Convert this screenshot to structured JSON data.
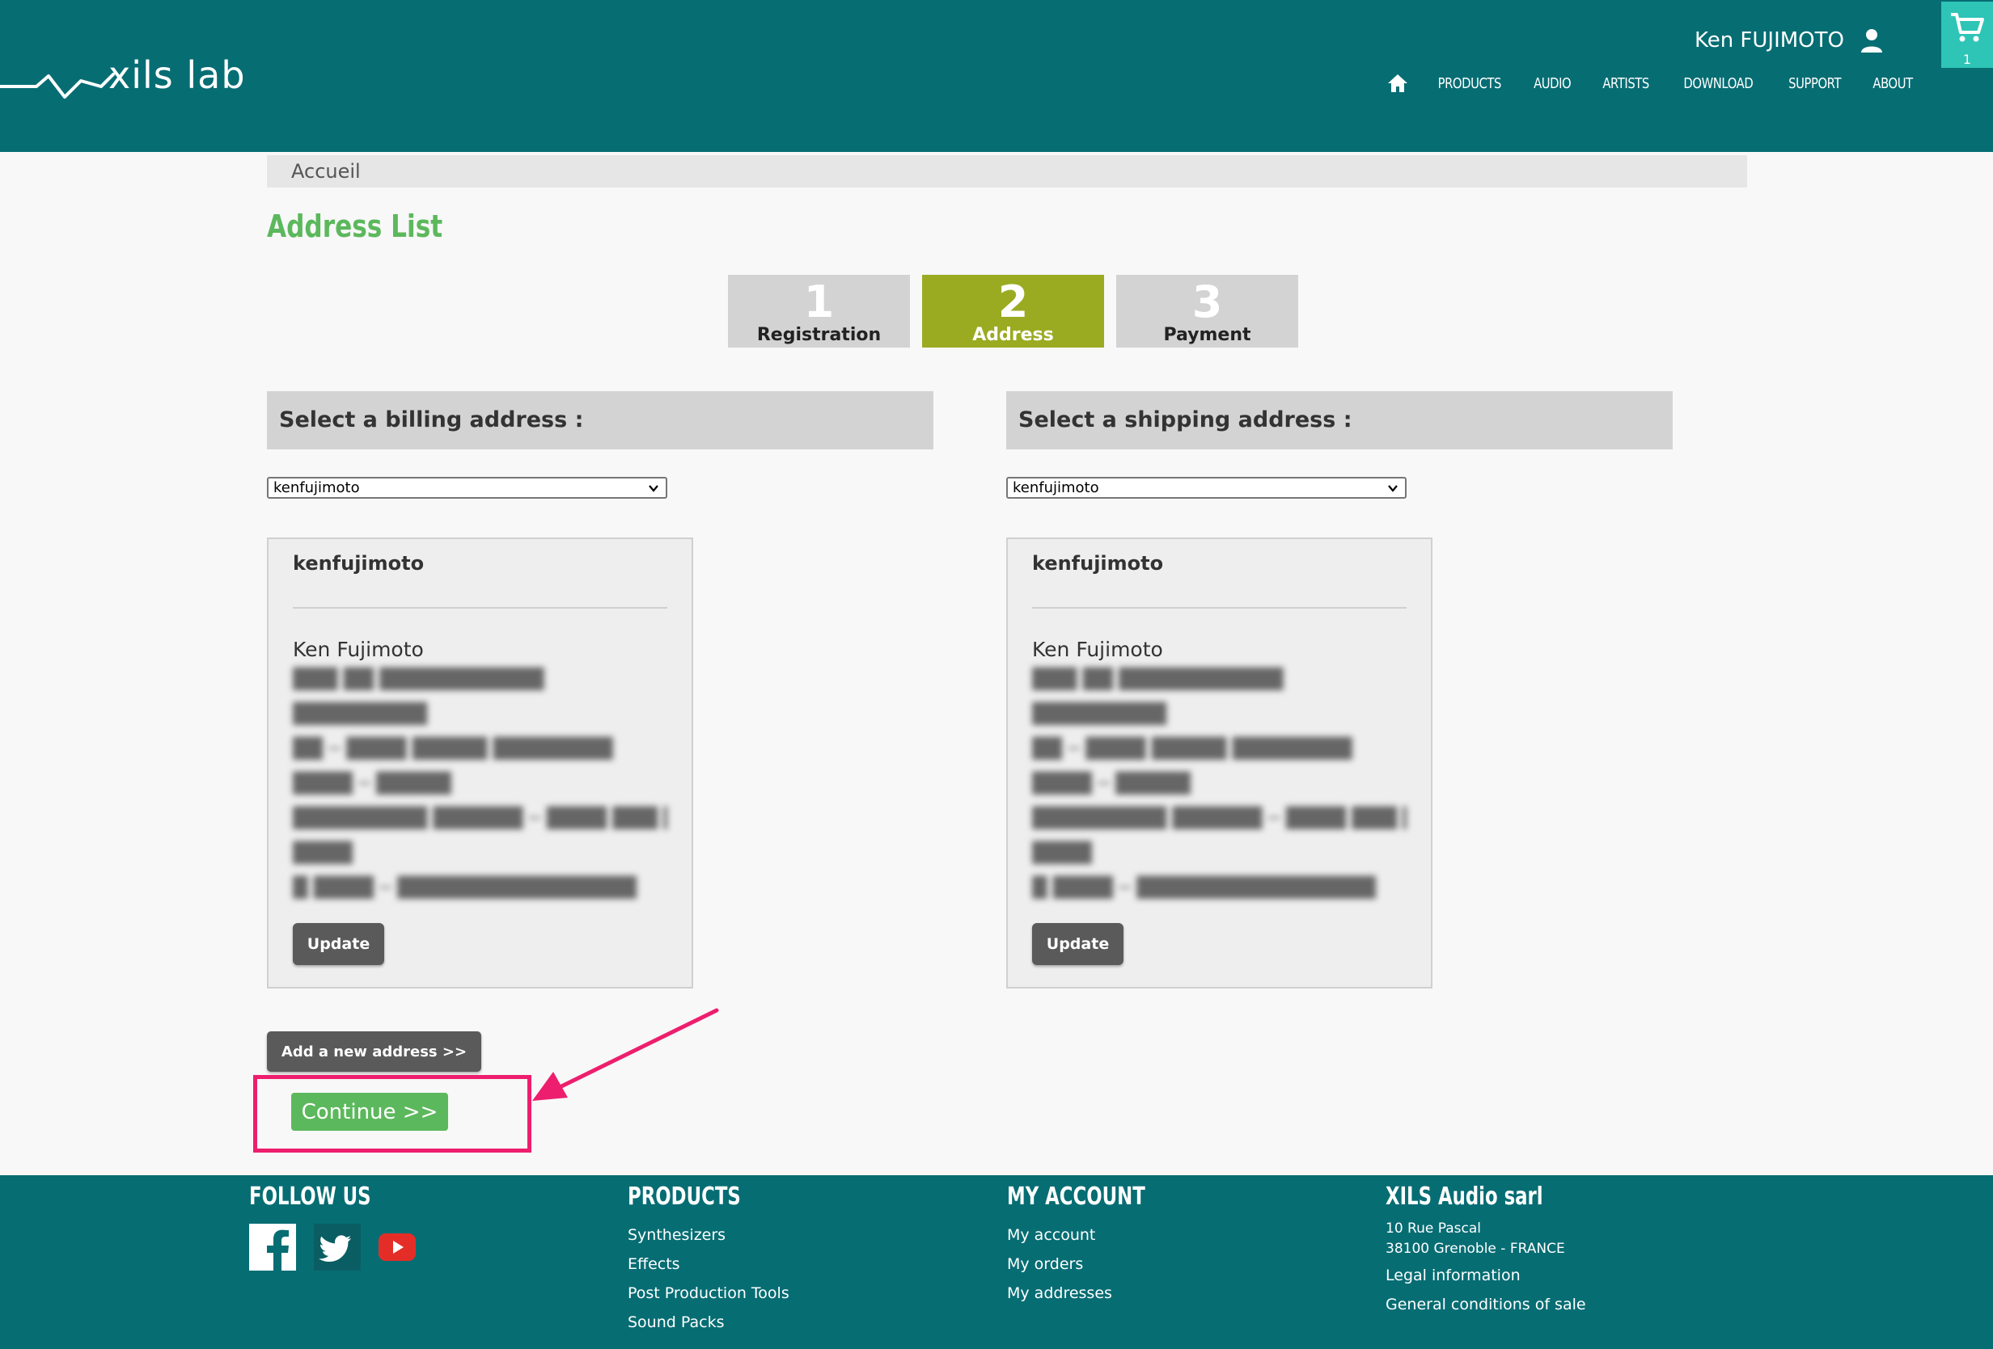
{
  "header": {
    "logo_text": "xils lab",
    "user_name": "Ken FUJIMOTO",
    "cart_count": "1",
    "nav": [
      "PRODUCTS",
      "AUDIO",
      "ARTISTS",
      "DOWNLOAD",
      "SUPPORT",
      "ABOUT"
    ]
  },
  "breadcrumb": "Accueil",
  "page_title": "Address List",
  "steps": [
    {
      "num": "1",
      "label": "Registration",
      "active": false
    },
    {
      "num": "2",
      "label": "Address",
      "active": true
    },
    {
      "num": "3",
      "label": "Payment",
      "active": false
    }
  ],
  "billing": {
    "heading": "Select a billing address :",
    "selected": "kenfujimoto",
    "card_title": "kenfujimoto",
    "name": "Ken Fujimoto",
    "update_label": "Update"
  },
  "shipping": {
    "heading": "Select a shipping address :",
    "selected": "kenfujimoto",
    "card_title": "kenfujimoto",
    "name": "Ken Fujimoto",
    "update_label": "Update"
  },
  "add_address_label": "Add a new address >>",
  "continue_label": "Continue >>",
  "footer": {
    "follow": "FOLLOW US",
    "products_head": "PRODUCTS",
    "products": [
      "Synthesizers",
      "Effects",
      "Post Production Tools",
      "Sound Packs"
    ],
    "account_head": "MY ACCOUNT",
    "account": [
      "My account",
      "My orders",
      "My addresses"
    ],
    "company_head": "XILS Audio sarl",
    "address_line1": "10 Rue Pascal",
    "address_line2": "38100 Grenoble - FRANCE",
    "legal": "Legal information",
    "conditions": "General conditions of sale"
  },
  "colors": {
    "header_bg": "#066d73",
    "accent_green": "#5cb85c",
    "step_active": "#9aab22",
    "highlight": "#ee1e6e"
  }
}
